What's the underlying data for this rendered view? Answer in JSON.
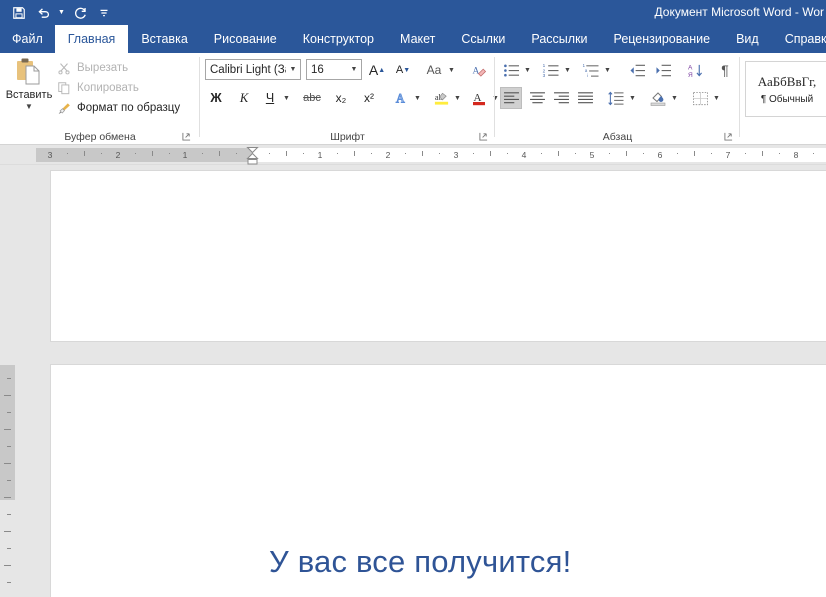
{
  "window": {
    "title": "Документ Microsoft Word  -  Wor",
    "accent_color": "#2b579a",
    "quick_access": [
      {
        "name": "save-icon",
        "label": "Сохранить"
      },
      {
        "name": "undo-icon",
        "label": "Отменить"
      },
      {
        "name": "redo-icon",
        "label": "Вернуть"
      },
      {
        "name": "customize-qat-icon",
        "label": "Настройка панели быстрого доступа"
      }
    ]
  },
  "tabs": [
    {
      "label": "Файл",
      "active": false
    },
    {
      "label": "Главная",
      "active": true
    },
    {
      "label": "Вставка",
      "active": false
    },
    {
      "label": "Рисование",
      "active": false
    },
    {
      "label": "Конструктор",
      "active": false
    },
    {
      "label": "Макет",
      "active": false
    },
    {
      "label": "Ссылки",
      "active": false
    },
    {
      "label": "Рассылки",
      "active": false
    },
    {
      "label": "Рецензирование",
      "active": false
    },
    {
      "label": "Вид",
      "active": false
    },
    {
      "label": "Справка",
      "active": false
    }
  ],
  "ribbon": {
    "clipboard": {
      "group_label": "Буфер обмена",
      "paste_label": "Вставить",
      "cut_label": "Вырезать",
      "copy_label": "Копировать",
      "format_painter_label": "Формат по образцу"
    },
    "font": {
      "group_label": "Шрифт",
      "font_name": "Calibri Light (За",
      "font_size": "16",
      "bold_label": "Ж",
      "italic_label": "К",
      "underline_label": "Ч",
      "strikethrough_label": "abc",
      "subscript_label": "x₂",
      "superscript_label": "x²",
      "change_case_label": "Aa",
      "grow_font_label": "A",
      "shrink_font_label": "A"
    },
    "paragraph": {
      "group_label": "Абзац"
    },
    "styles": {
      "sample_text": "АаБбВвГг,",
      "style_name": "¶ Обычный"
    }
  },
  "ruler": {
    "left_labels": [
      "3",
      "2",
      "1"
    ],
    "right_labels": [
      "1",
      "2",
      "3",
      "4",
      "5",
      "6",
      "7",
      "8"
    ]
  },
  "document": {
    "body_text": "У вас все получится!",
    "text_color": "#2f5496"
  }
}
